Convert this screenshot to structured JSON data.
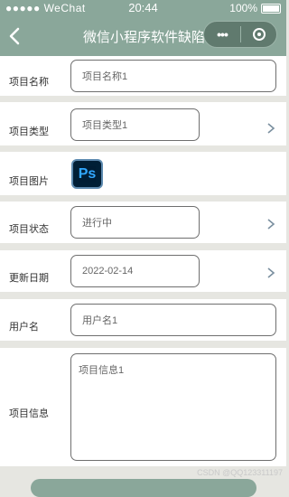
{
  "status_bar": {
    "signal": "●●●●● WeChat",
    "time": "20:44",
    "battery": "100%"
  },
  "nav": {
    "title": "微信小程序软件缺陷..."
  },
  "form": {
    "name": {
      "label": "项目名称",
      "value": "项目名称1"
    },
    "type": {
      "label": "项目类型",
      "value": "项目类型1"
    },
    "image": {
      "label": "项目图片",
      "icon_text": "Ps"
    },
    "status": {
      "label": "项目状态",
      "value": "进行中"
    },
    "date": {
      "label": "更新日期",
      "value": "2022-02-14"
    },
    "user": {
      "label": "用户名",
      "value": "用户名1"
    },
    "info": {
      "label": "项目信息",
      "value": "项目信息1"
    }
  },
  "watermark": "CSDN @QQ123311197",
  "colors": {
    "accent": "#8aa79a",
    "capsule": "#607a6e",
    "page_bg": "#e6e6e1"
  }
}
